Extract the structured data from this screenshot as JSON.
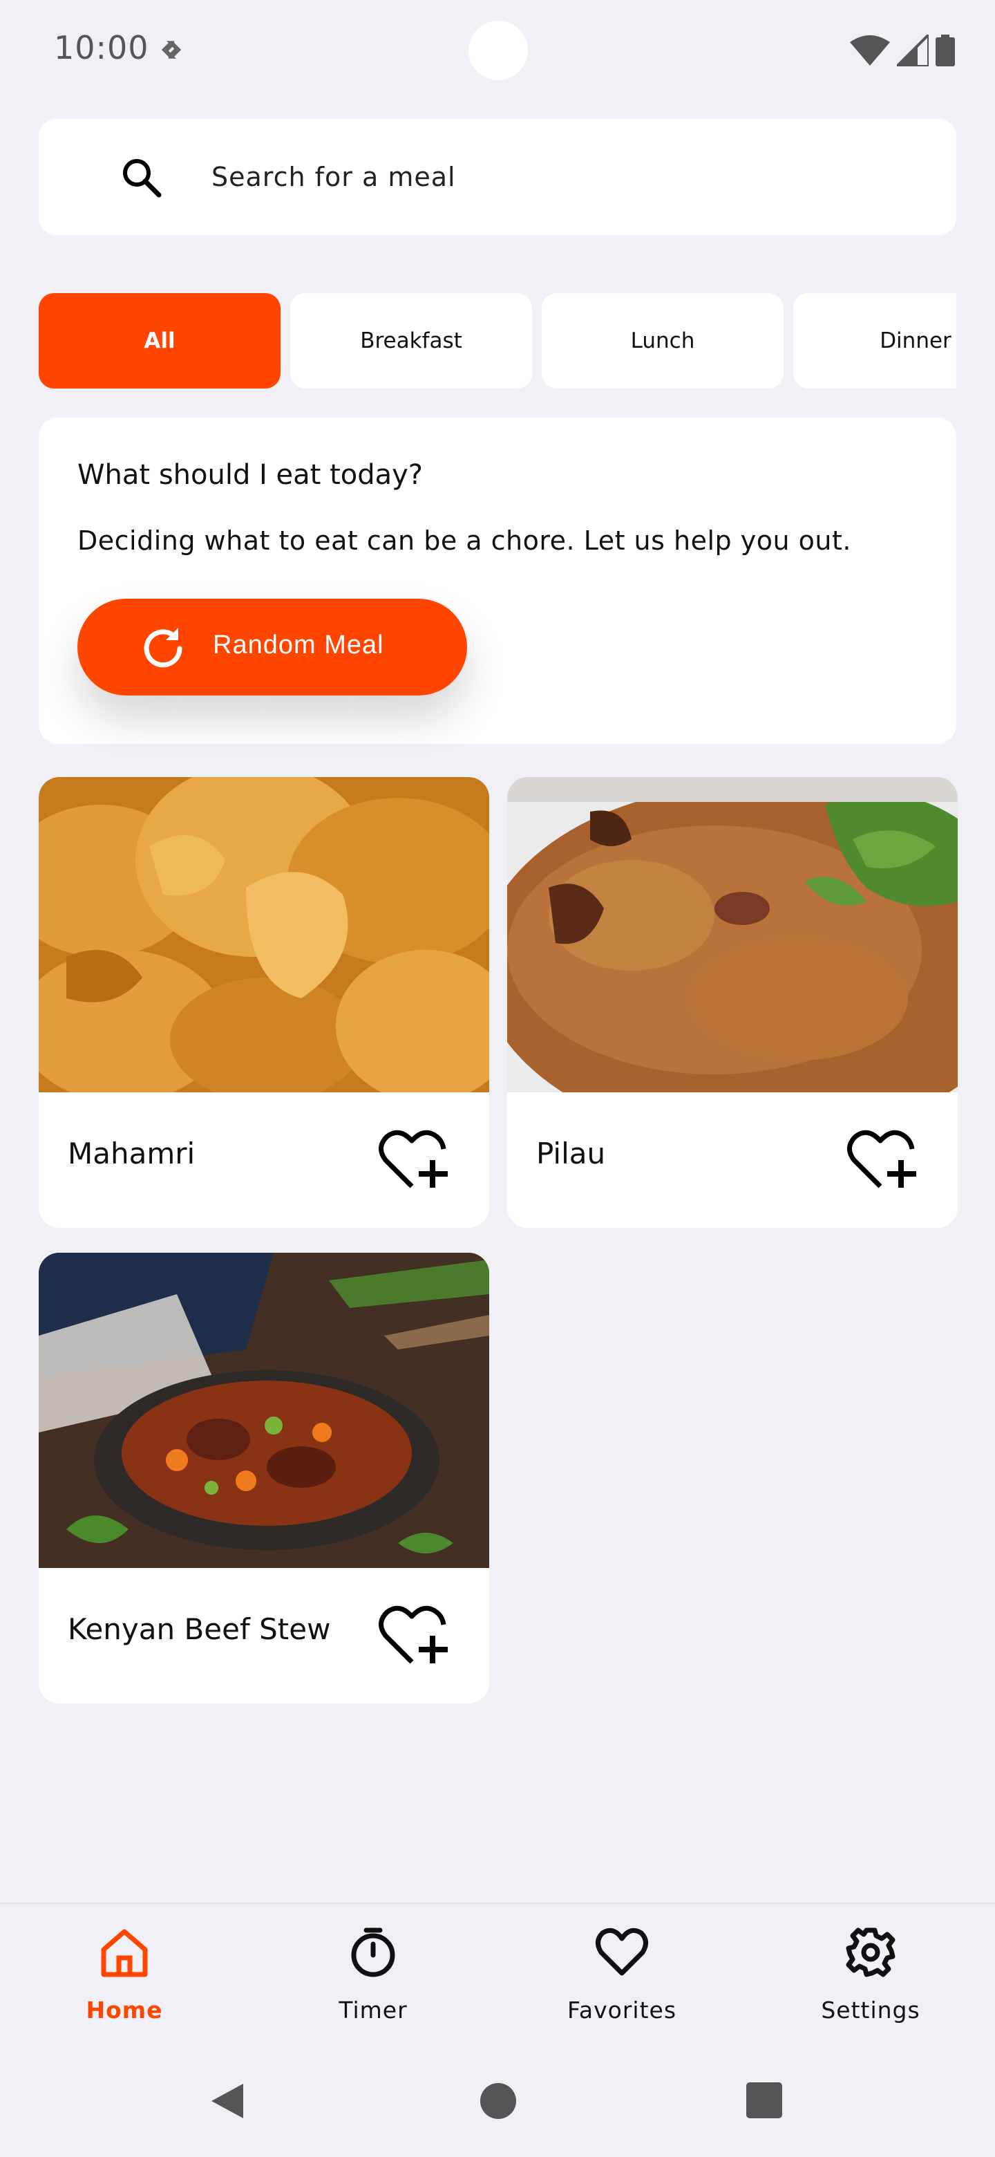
{
  "status_bar": {
    "time": "10:00"
  },
  "search": {
    "placeholder": "Search for a meal"
  },
  "categories": [
    {
      "label": "All",
      "active": true
    },
    {
      "label": "Breakfast",
      "active": false
    },
    {
      "label": "Lunch",
      "active": false
    },
    {
      "label": "Dinner",
      "active": false
    }
  ],
  "suggestion": {
    "title": "What should I eat today?",
    "text": "Deciding what to eat can be a chore. Let us help you out.",
    "button_label": "Random Meal"
  },
  "meals": [
    {
      "name": "Mahamri",
      "image": "mahamri-photo"
    },
    {
      "name": "Pilau",
      "image": "pilau-photo"
    },
    {
      "name": "Kenyan Beef Stew",
      "image": "beef-stew-photo"
    }
  ],
  "nav": {
    "items": [
      {
        "label": "Home",
        "icon": "home-icon",
        "active": true
      },
      {
        "label": "Timer",
        "icon": "timer-icon",
        "active": false
      },
      {
        "label": "Favorites",
        "icon": "heart-icon",
        "active": false
      },
      {
        "label": "Settings",
        "icon": "gear-icon",
        "active": false
      }
    ]
  },
  "colors": {
    "accent": "#ff4500",
    "background": "#f1f0f6",
    "card": "#ffffff"
  }
}
